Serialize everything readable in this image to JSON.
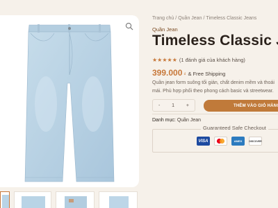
{
  "breadcrumb": [
    "Trang chủ",
    "Quần Jean",
    "Timeless Classic Jeans"
  ],
  "breadcrumb_separator": "/",
  "product": {
    "category": "Quần Jean",
    "title": "Timeless Classic Jean",
    "rating_stars": "★★★★★",
    "rating_value": 5,
    "review_text": "(1 đánh giá của khách hàng)",
    "price": "399.000",
    "currency": "₫",
    "shipping": "& Free Shipping",
    "description": "Quần jean form suông tối giản, chất denim mềm và thoái mái. Phù hợp phối theo phong cách basic và streetwear."
  },
  "quantity": {
    "minus": "-",
    "value": "1",
    "plus": "+"
  },
  "add_to_cart_label": "THÊM VÀO GIỎ HÀNG",
  "meta": {
    "category_key": "Danh mục:",
    "category_value": "Quần Jean"
  },
  "checkout": {
    "title": "Guaranteed Safe Checkout",
    "cards": [
      "VISA",
      "mastercard",
      "AMEX",
      "DISCOVER"
    ]
  },
  "colors": {
    "accent": "#c7783a",
    "background": "#f6f1ea",
    "denim": "#b9d4e6"
  }
}
